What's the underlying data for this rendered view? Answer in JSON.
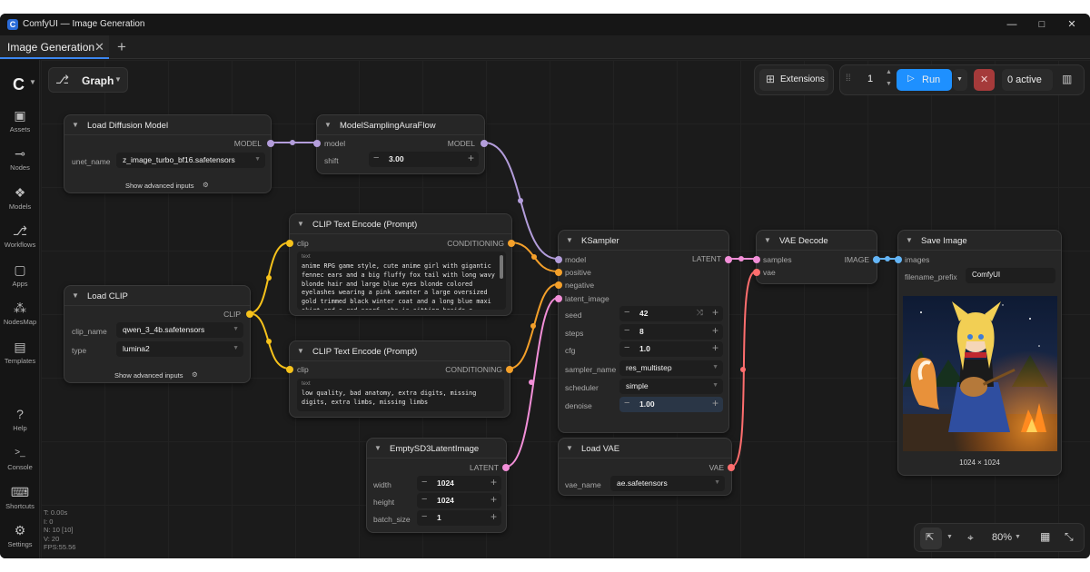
{
  "window": {
    "title": "ComfyUI — Image Generation",
    "app_icon": "C",
    "controls": [
      "—",
      "□",
      "✕"
    ]
  },
  "tab": {
    "label": "Image Generation",
    "close": "✕",
    "add": "+"
  },
  "sidebar": {
    "logo": "C",
    "items": [
      {
        "label": "Assets",
        "icon": "image-icon",
        "glyph": "▣"
      },
      {
        "label": "Nodes",
        "icon": "node-icon",
        "glyph": "⊸"
      },
      {
        "label": "Models",
        "icon": "models-icon",
        "glyph": "❖"
      },
      {
        "label": "Workflows",
        "icon": "workflow-icon",
        "glyph": "⎇"
      },
      {
        "label": "Apps",
        "icon": "apps-icon",
        "glyph": "▢"
      },
      {
        "label": "NodesMap",
        "icon": "nodesmap-icon",
        "glyph": "⁂"
      },
      {
        "label": "Templates",
        "icon": "templates-icon",
        "glyph": "▤"
      }
    ],
    "bottom": [
      {
        "label": "Help",
        "icon": "help-icon",
        "glyph": "?"
      },
      {
        "label": "Console",
        "icon": "console-icon",
        "glyph": ">_"
      },
      {
        "label": "Shortcuts",
        "icon": "keyboard-icon",
        "glyph": "⌨"
      },
      {
        "label": "Settings",
        "icon": "gear-icon",
        "glyph": "⚙"
      }
    ]
  },
  "stats": {
    "t": "T: 0.00s",
    "i": "I: 0",
    "n": "N: 10 [10]",
    "v": "V: 20",
    "fps": "FPS:55.56"
  },
  "graph_button": {
    "label": "Graph"
  },
  "toolbar": {
    "extensions": "Extensions",
    "queue_count": "1",
    "run": "Run",
    "active": "0 active"
  },
  "nodes": {
    "load_diffusion": {
      "title": "Load Diffusion Model",
      "out_model": "MODEL",
      "unet_label": "unet_name",
      "unet_value": "z_image_turbo_bf16.safetensors",
      "advanced": "Show advanced inputs"
    },
    "sampling_aura": {
      "title": "ModelSamplingAuraFlow",
      "in_model": "model",
      "out_model": "MODEL",
      "shift_label": "shift",
      "shift_value": "3.00"
    },
    "clip_pos": {
      "title": "CLIP Text Encode (Prompt)",
      "in_clip": "clip",
      "out_cond": "CONDITIONING",
      "text_label": "text",
      "text": "anime RPG game style, cute anime girl with gigantic fennec ears and a big fluffy fox tail with long wavy blonde hair and large blue eyes blonde colored eyelashes wearing a pink sweater a large oversized gold trimmed black winter coat and a long blue maxi skirt and a red scarf, she is sitting beside a"
    },
    "clip_neg": {
      "title": "CLIP Text Encode (Prompt)",
      "in_clip": "clip",
      "out_cond": "CONDITIONING",
      "text_label": "text",
      "text": "low quality, bad anatomy, extra digits, missing digits, extra limbs, missing limbs"
    },
    "load_clip": {
      "title": "Load CLIP",
      "out_clip": "CLIP",
      "clip_name_label": "clip_name",
      "clip_name_value": "qwen_3_4b.safetensors",
      "type_label": "type",
      "type_value": "lumina2",
      "advanced": "Show advanced inputs"
    },
    "ksampler": {
      "title": "KSampler",
      "inputs": [
        "model",
        "positive",
        "negative",
        "latent_image"
      ],
      "out_latent": "LATENT",
      "widgets": [
        {
          "label": "seed",
          "value": "42"
        },
        {
          "label": "steps",
          "value": "8"
        },
        {
          "label": "cfg",
          "value": "1.0"
        },
        {
          "label": "sampler_name",
          "value": "res_multistep"
        },
        {
          "label": "scheduler",
          "value": "simple"
        },
        {
          "label": "denoise",
          "value": "1.00"
        }
      ]
    },
    "empty_latent": {
      "title": "EmptySD3LatentImage",
      "out_latent": "LATENT",
      "widgets": [
        {
          "label": "width",
          "value": "1024"
        },
        {
          "label": "height",
          "value": "1024"
        },
        {
          "label": "batch_size",
          "value": "1"
        }
      ]
    },
    "vae_decode": {
      "title": "VAE Decode",
      "in_samples": "samples",
      "in_vae": "vae",
      "out_image": "IMAGE"
    },
    "load_vae": {
      "title": "Load VAE",
      "out_vae": "VAE",
      "vae_label": "vae_name",
      "vae_value": "ae.safetensors"
    },
    "save_image": {
      "title": "Save Image",
      "in_images": "images",
      "prefix_label": "filename_prefix",
      "prefix_value": "ComfyUI",
      "dims": "1024 × 1024"
    }
  },
  "zoom": {
    "level": "80%"
  },
  "colors": {
    "model": "#b39ddb",
    "clip": "#f6c21b",
    "conditioning": "#f4a02a",
    "latent": "#f28fd8",
    "vae": "#ff6e6e",
    "image": "#64b5f6",
    "run": "#1e90ff"
  }
}
